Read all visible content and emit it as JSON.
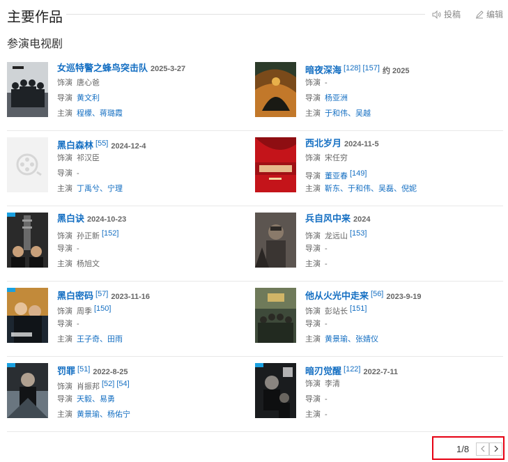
{
  "header": {
    "title": "主要作品",
    "report_label": "投稿",
    "edit_label": "编辑"
  },
  "section": {
    "subtitle": "参演电视剧"
  },
  "labels": {
    "role": "饰演",
    "director": "导演",
    "star": "主演"
  },
  "items": [
    {
      "name": "女巡特警之蜂鸟突击队",
      "refs": [],
      "date": "2025-3-27",
      "role": "唐心爸",
      "role_refs": [],
      "director": "黄文利",
      "director_link": true,
      "director_refs": [],
      "star": "程檬、蒋璐霞",
      "star_link": true,
      "poster": "police"
    },
    {
      "name": "暗夜深海",
      "refs": [
        "[128]",
        "[157]"
      ],
      "date": "约 2025",
      "role": "-",
      "role_refs": [],
      "director": "杨亚洲",
      "director_link": true,
      "director_refs": [],
      "star": "于和伟、吴越",
      "star_link": true,
      "poster": "deepsea"
    },
    {
      "name": "黑白森林",
      "refs": [
        "[55]"
      ],
      "date": "2024-12-4",
      "role": "祁汉臣",
      "role_refs": [],
      "director": "-",
      "director_link": false,
      "director_refs": [],
      "star": "丁禹兮、宁理",
      "star_link": true,
      "poster": "placeholder"
    },
    {
      "name": "西北岁月",
      "refs": [],
      "date": "2024-11-5",
      "role": "宋任穷",
      "role_refs": [],
      "director": "董亚春",
      "director_link": true,
      "director_refs": [
        "[149]"
      ],
      "star": "靳东、于和伟、吴磊、倪妮",
      "star_link": true,
      "poster": "northwest"
    },
    {
      "name": "黑白诀",
      "refs": [],
      "date": "2024-10-23",
      "role": "孙正新",
      "role_refs": [
        "[152]"
      ],
      "director": "-",
      "director_link": false,
      "director_refs": [],
      "star": "杨旭文",
      "star_link": false,
      "poster": "tower"
    },
    {
      "name": "兵自风中来",
      "refs": [],
      "date": "2024",
      "role": "龙远山",
      "role_refs": [
        "[153]"
      ],
      "director": "-",
      "director_link": false,
      "director_refs": [],
      "star": "-",
      "star_link": false,
      "poster": "soldier"
    },
    {
      "name": "黑白密码",
      "refs": [
        "[57]"
      ],
      "date": "2023-11-16",
      "role": "周季",
      "role_refs": [
        "[150]"
      ],
      "director": "-",
      "director_link": false,
      "director_refs": [],
      "star": "王子奇、田雨",
      "star_link": true,
      "poster": "code"
    },
    {
      "name": "他从火光中走来",
      "refs": [
        "[56]"
      ],
      "date": "2023-9-19",
      "role": "彭站长",
      "role_refs": [
        "[151]"
      ],
      "director": "-",
      "director_link": false,
      "director_refs": [],
      "star": "黄景瑜、张婧仪",
      "star_link": true,
      "poster": "fire"
    },
    {
      "name": "罚罪",
      "refs": [
        "[51]"
      ],
      "date": "2022-8-25",
      "role": "肖振邦",
      "role_refs": [
        "[52]",
        "[54]"
      ],
      "director": "天毅、易勇",
      "director_link": true,
      "director_refs": [],
      "star": "黄景瑜、杨佑宁",
      "star_link": true,
      "poster": "punish"
    },
    {
      "name": "暗刃觉醒",
      "refs": [
        "[122]"
      ],
      "date": "2022-7-11",
      "role": "李清",
      "role_refs": [],
      "director": "-",
      "director_link": false,
      "director_refs": [],
      "star": "-",
      "star_link": false,
      "poster": "blade"
    }
  ],
  "pager": {
    "text": "1/8"
  },
  "colors": {
    "link": "#136ec2",
    "highlight_border": "#e60012"
  }
}
